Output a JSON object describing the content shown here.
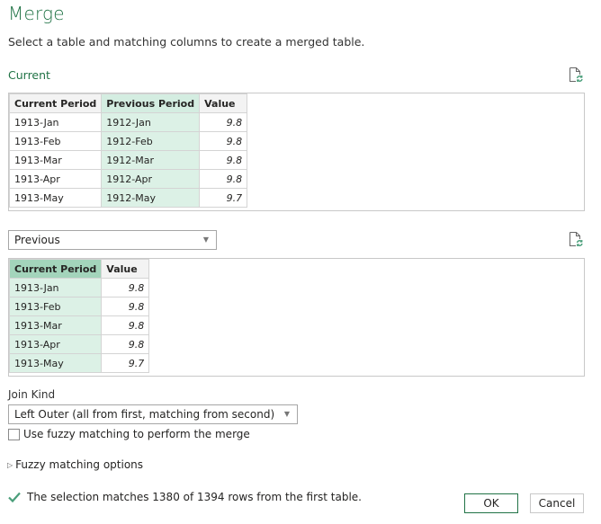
{
  "dialog": {
    "title": "Merge",
    "subtitle": "Select a table and matching columns to create a merged table."
  },
  "first_table": {
    "name": "Current",
    "refresh_icon": "document-refresh-icon",
    "columns": [
      "Current Period",
      "Previous Period",
      "Value"
    ],
    "selected_column": "Previous Period",
    "rows": [
      [
        "1913-Jan",
        "1912-Jan",
        "9.8"
      ],
      [
        "1913-Feb",
        "1912-Feb",
        "9.8"
      ],
      [
        "1913-Mar",
        "1912-Mar",
        "9.8"
      ],
      [
        "1913-Apr",
        "1912-Apr",
        "9.8"
      ],
      [
        "1913-May",
        "1912-May",
        "9.7"
      ]
    ]
  },
  "second_table": {
    "selected": "Previous",
    "refresh_icon": "document-refresh-icon",
    "columns": [
      "Current Period",
      "Value"
    ],
    "selected_column": "Current Period",
    "rows": [
      [
        "1913-Jan",
        "9.8"
      ],
      [
        "1913-Feb",
        "9.8"
      ],
      [
        "1913-Mar",
        "9.8"
      ],
      [
        "1913-Apr",
        "9.8"
      ],
      [
        "1913-May",
        "9.7"
      ]
    ]
  },
  "join": {
    "label": "Join Kind",
    "selected": "Left Outer (all from first, matching from second)"
  },
  "fuzzy": {
    "checkbox_label": "Use fuzzy matching to perform the merge",
    "checked": false,
    "options_label": "Fuzzy matching options"
  },
  "status": {
    "icon": "checkmark-icon",
    "text": "The selection matches 1380 of 1394 rows from the first table.",
    "color": "#4a9e7a"
  },
  "buttons": {
    "ok": "OK",
    "cancel": "Cancel"
  },
  "colors": {
    "accent": "#217346",
    "selected_column": "#dcf1e6",
    "selected_header": "#a3d4bb"
  }
}
